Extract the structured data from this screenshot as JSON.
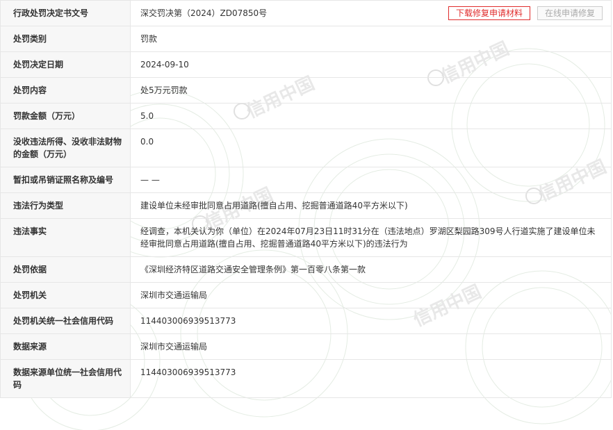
{
  "decision_no": {
    "label": "行政处罚决定书文号",
    "value": "深交罚决第（2024）ZD07850号"
  },
  "buttons": {
    "download": "下载修复申请材料",
    "online": "在线申请修复"
  },
  "watermark": "信用中国",
  "rows": [
    {
      "label": "处罚类别",
      "value": "罚款"
    },
    {
      "label": "处罚决定日期",
      "value": "2024-09-10"
    },
    {
      "label": "处罚内容",
      "value": "处5万元罚款"
    },
    {
      "label": "罚款金额（万元）",
      "value": "5.0"
    },
    {
      "label": "没收违法所得、没收非法财物的金额（万元）",
      "value": "0.0"
    },
    {
      "label": "暂扣或吊销证照名称及编号",
      "value": "— —"
    },
    {
      "label": "违法行为类型",
      "value": "建设单位未经审批同意占用道路(擅自占用、挖掘普通道路40平方米以下)"
    },
    {
      "label": "违法事实",
      "value": "经调查，本机关认为你（单位）在2024年07月23日11时31分在（违法地点）罗湖区梨园路309号人行道实施了建设单位未经审批同意占用道路(擅自占用、挖掘普通道路40平方米以下)的违法行为"
    },
    {
      "label": "处罚依据",
      "value": "《深圳经济特区道路交通安全管理条例》第一百零八条第一款"
    },
    {
      "label": "处罚机关",
      "value": "深圳市交通运输局"
    },
    {
      "label": "处罚机关统一社会信用代码",
      "value": "11440300693951377３"
    },
    {
      "label": "数据来源",
      "value": "深圳市交通运输局"
    },
    {
      "label": "数据来源单位统一社会信用代码",
      "value": "114403006939513773"
    }
  ],
  "colors": {
    "accent_red": "#e02b2b",
    "label_bg": "#f7f7f7",
    "border": "#e6e6e6",
    "watermark": "#e2ebe2"
  }
}
